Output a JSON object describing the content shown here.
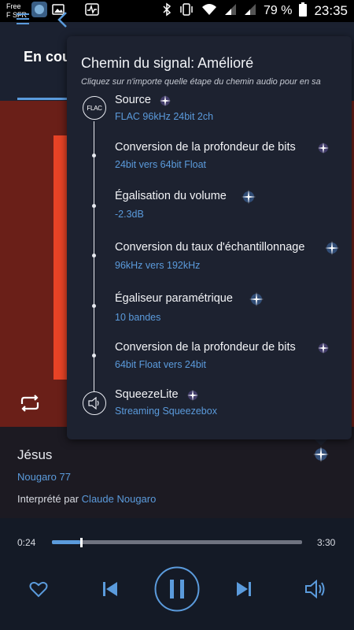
{
  "status_bar": {
    "carrier_line1": "Free",
    "carrier_line2": "F SFR",
    "battery": "79 %",
    "time": "23:35"
  },
  "header": {
    "tab_now_playing": "En cou"
  },
  "signal_path": {
    "title_prefix": "Chemin du signal:",
    "title_value": "Amélioré",
    "subtitle": "Cliquez sur n'importe quelle étape du chemin audio pour en sa",
    "source_badge": "FLAC",
    "steps": [
      {
        "title": "Source",
        "detail": "FLAC 96kHz 24bit 2ch"
      },
      {
        "title": "Conversion de la profondeur de bits",
        "detail": "24bit vers 64bit Float"
      },
      {
        "title": "Égalisation du volume",
        "detail": "-2.3dB"
      },
      {
        "title": "Conversion du taux d'échantillonnage",
        "detail": "96kHz vers 192kHz"
      },
      {
        "title": "Égaliseur paramétrique",
        "detail": "10 bandes"
      },
      {
        "title": "Conversion de la profondeur de bits",
        "detail": "64bit Float vers 24bit"
      },
      {
        "title": "SqueezeLite",
        "detail": "Streaming Squeezebox"
      }
    ]
  },
  "track": {
    "title": "Jésus",
    "album": "Nougaro 77",
    "performed_by_label": "Interprété par",
    "artist": "Claude Nougaro"
  },
  "player": {
    "elapsed": "0:24",
    "total": "3:30",
    "progress": 0.114
  },
  "colors": {
    "accent": "#5b9bdc",
    "popup_bg": "#1d2230",
    "app_bg": "#141a26",
    "art_red": "#e84326"
  }
}
